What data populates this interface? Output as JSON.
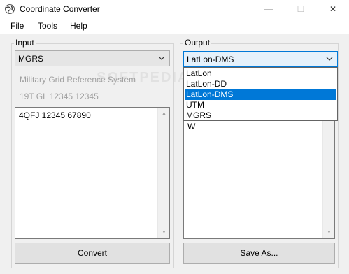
{
  "window": {
    "title": "Coordinate Converter",
    "minimize_glyph": "—",
    "maximize_glyph": "☐",
    "close_glyph": "✕"
  },
  "menu": [
    "File",
    "Tools",
    "Help"
  ],
  "input": {
    "label": "Input",
    "format": "MGRS",
    "format_description": "Military Grid Reference System",
    "example": "19T GL 12345 12345",
    "text": "4QFJ 12345 67890",
    "button": "Convert"
  },
  "output": {
    "label": "Output",
    "format": "LatLon-DMS",
    "partial_text": "W",
    "button": "Save As...",
    "dropdown_options": [
      "LatLon",
      "LatLon-DD",
      "LatLon-DMS",
      "UTM",
      "MGRS"
    ],
    "selected_index": 2
  },
  "watermark": "SOFTPEDIA",
  "colors": {
    "accent": "#0078d7",
    "dropdown_highlight": "#0078d7"
  }
}
